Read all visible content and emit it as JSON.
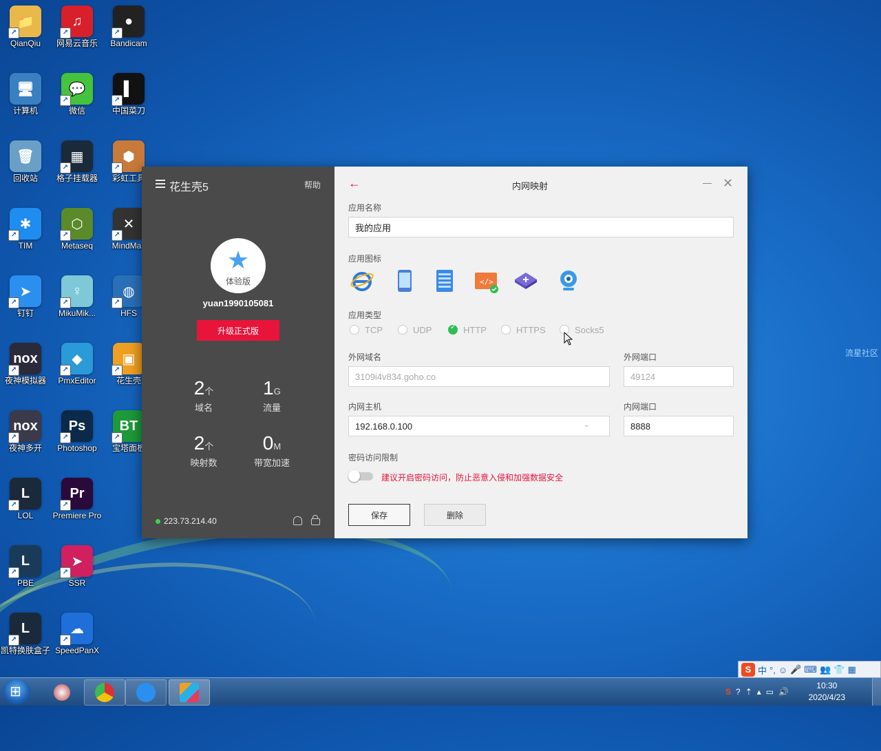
{
  "desktop": {
    "icons": [
      {
        "label": "QianQiu",
        "glyph": "📁",
        "color": "#e9b84a"
      },
      {
        "label": "网易云音乐",
        "glyph": "♫",
        "color": "#d8202a"
      },
      {
        "label": "Bandicam",
        "glyph": "●",
        "color": "#222222"
      },
      {
        "label": "计算机",
        "glyph": "🖥",
        "color": "#3a7fc0"
      },
      {
        "label": "微信",
        "glyph": "💬",
        "color": "#45c33c"
      },
      {
        "label": "中国菜刀",
        "glyph": "▌",
        "color": "#111111"
      },
      {
        "label": "回收站",
        "glyph": "🗑",
        "color": "#6aa0c8"
      },
      {
        "label": "格子挂载器",
        "glyph": "▦",
        "color": "#1a2a3a"
      },
      {
        "label": "彩虹工具",
        "glyph": "⬢",
        "color": "#c87a3a"
      },
      {
        "label": "TIM",
        "glyph": "✱",
        "color": "#1f8cf0"
      },
      {
        "label": "Metaseq",
        "glyph": "⬡",
        "color": "#5a8a2a"
      },
      {
        "label": "MindMas",
        "glyph": "✕",
        "color": "#333333"
      },
      {
        "label": "钉钉",
        "glyph": "➤",
        "color": "#2b8ff0"
      },
      {
        "label": "MikuMik...",
        "glyph": "♀",
        "color": "#7ec8d8"
      },
      {
        "label": "HFS",
        "glyph": "◍",
        "color": "#2a70b8"
      },
      {
        "label": "夜神模拟器",
        "glyph": "nox",
        "color": "#2a2a3a"
      },
      {
        "label": "PmxEditor",
        "glyph": "◆",
        "color": "#2a9ad8"
      },
      {
        "label": "花生壳",
        "glyph": "▣",
        "color": "#f0a020"
      },
      {
        "label": "夜神多开",
        "glyph": "nox",
        "color": "#3a3a4a"
      },
      {
        "label": "Photoshop",
        "glyph": "Ps",
        "color": "#0b2a4a"
      },
      {
        "label": "宝塔面板",
        "glyph": "BT",
        "color": "#1d9a3a"
      },
      {
        "label": "LOL",
        "glyph": "L",
        "color": "#1a2a3a"
      },
      {
        "label": "Premiere Pro",
        "glyph": "Pr",
        "color": "#2a0a3a"
      },
      {
        "label": "PBE",
        "glyph": "L",
        "color": "#1a3a5a"
      },
      {
        "label": "SSR",
        "glyph": "➤",
        "color": "#d02060"
      },
      {
        "label": "凯特换肤盒子",
        "glyph": "L",
        "color": "#1a2a3a"
      },
      {
        "label": "SpeedPanX",
        "glyph": "☁",
        "color": "#1f6fd8"
      }
    ],
    "side_text": "流星社区"
  },
  "app": {
    "left": {
      "brand": "花生壳5",
      "help": "帮助",
      "avatar_badge": "体验版",
      "username": "yuan1990105081",
      "upgrade_label": "升级正式版",
      "stats": [
        {
          "num": "2",
          "unit": "个",
          "cap": "域名"
        },
        {
          "num": "1",
          "unit": "G",
          "cap": "流量"
        },
        {
          "num": "2",
          "unit": "个",
          "cap": "映射数"
        },
        {
          "num": "0",
          "unit": "M",
          "cap": "带宽加速"
        }
      ],
      "ip": "223.73.214.40"
    },
    "right": {
      "title": "内网映射",
      "app_name_label": "应用名称",
      "app_name_value": "我的应用",
      "app_icon_label": "应用图标",
      "app_type_label": "应用类型",
      "types": [
        "TCP",
        "UDP",
        "HTTP",
        "HTTPS",
        "Socks5"
      ],
      "selected_type": "HTTP",
      "ext_domain_label": "外网域名",
      "ext_domain_value": "3109i4v834.goho.co",
      "ext_port_label": "外网端口",
      "ext_port_value": "49124",
      "int_host_label": "内网主机",
      "int_host_value": "192.168.0.100",
      "int_port_label": "内网端口",
      "int_port_value": "8888",
      "pwd_label": "密码访问限制",
      "pwd_warning": "建议开启密码访问，防止恶意入侵和加强数据安全",
      "save_label": "保存",
      "delete_label": "删除"
    }
  },
  "tray_bar": {
    "ime_mode": "中"
  },
  "taskbar": {
    "time": "10:30",
    "date": "2020/4/23"
  }
}
